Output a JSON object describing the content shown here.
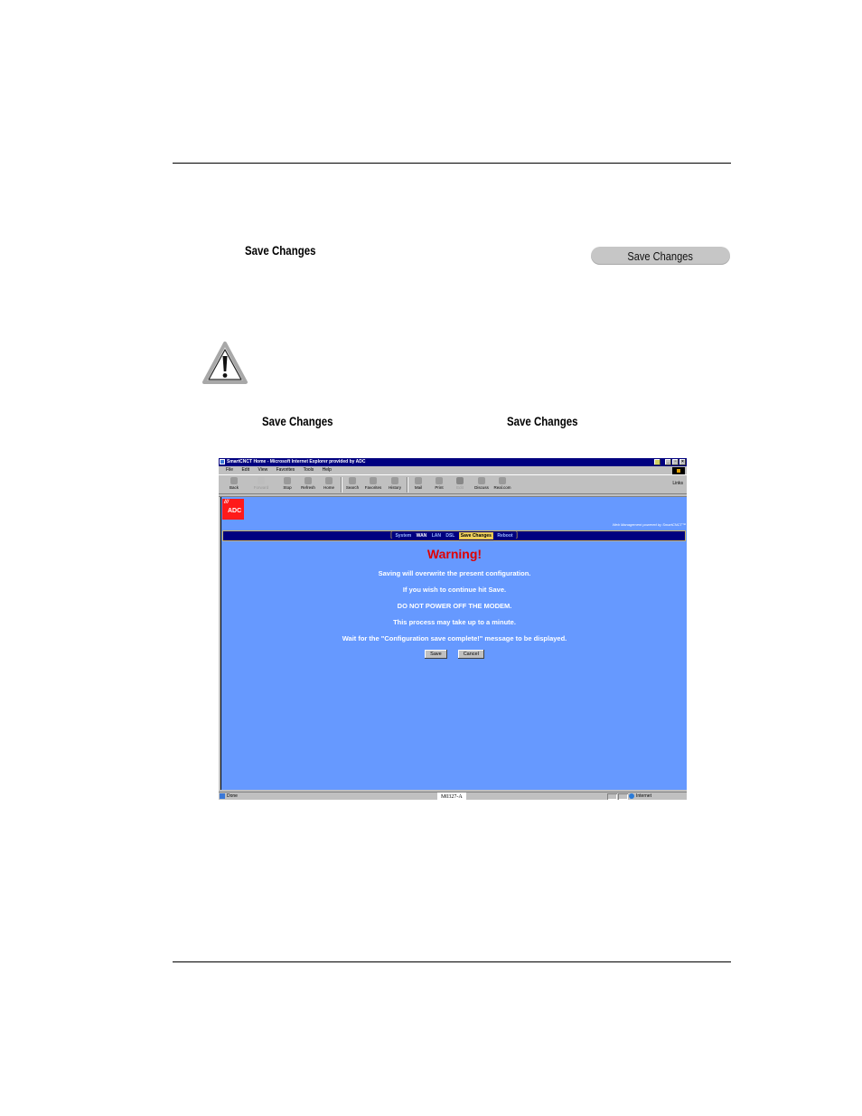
{
  "document": {
    "heading_label": "Save Changes",
    "button_graphic_label": "Save Changes",
    "body_label_1": "Save Changes",
    "body_label_2": "Save Changes",
    "figure_id": "M0327-A"
  },
  "browser": {
    "window_title": "SmartCNCT Home - Microsoft Internet Explorer provided by ADC",
    "window_buttons": [
      "_",
      "▫",
      "×"
    ],
    "menu": [
      "File",
      "Edit",
      "View",
      "Favorites",
      "Tools",
      "Help"
    ],
    "toolbar": [
      {
        "label": "Back",
        "icon": "back-arrow-icon"
      },
      {
        "label": "Forward",
        "icon": "forward-arrow-icon",
        "disabled": true
      },
      {
        "label": "Stop",
        "icon": "stop-icon"
      },
      {
        "label": "Refresh",
        "icon": "refresh-icon"
      },
      {
        "label": "Home",
        "icon": "home-icon"
      },
      {
        "label": "Search",
        "icon": "search-icon"
      },
      {
        "label": "Favorites",
        "icon": "favorites-icon"
      },
      {
        "label": "History",
        "icon": "history-icon"
      },
      {
        "label": "Mail",
        "icon": "mail-icon"
      },
      {
        "label": "Print",
        "icon": "print-icon"
      },
      {
        "label": "Edit",
        "icon": "edit-icon",
        "disabled": true
      },
      {
        "label": "Discuss",
        "icon": "discuss-icon"
      },
      {
        "label": "Real.com",
        "icon": "realcom-icon"
      }
    ],
    "links_label": "Links",
    "status": {
      "text": "Done",
      "zone": "Internet"
    }
  },
  "page": {
    "logo_text": "ADC",
    "powered_by": "Web Management powered by SmartCNCT™",
    "nav": {
      "open_bracket": "[",
      "close_bracket": "]",
      "items": [
        "System",
        "WAN",
        "LAN",
        "DSL",
        "Save Changes",
        "Reboot"
      ],
      "active": "Save Changes"
    },
    "warning_title": "Warning!",
    "messages": [
      "Saving will overwrite the present configuration.",
      "If you wish to continue hit Save.",
      "DO NOT POWER OFF THE MODEM.",
      "This process may take up to a minute.",
      "Wait for the \"Configuration save complete!\" message to be displayed."
    ],
    "save_label": "Save",
    "cancel_label": "Cancel"
  }
}
